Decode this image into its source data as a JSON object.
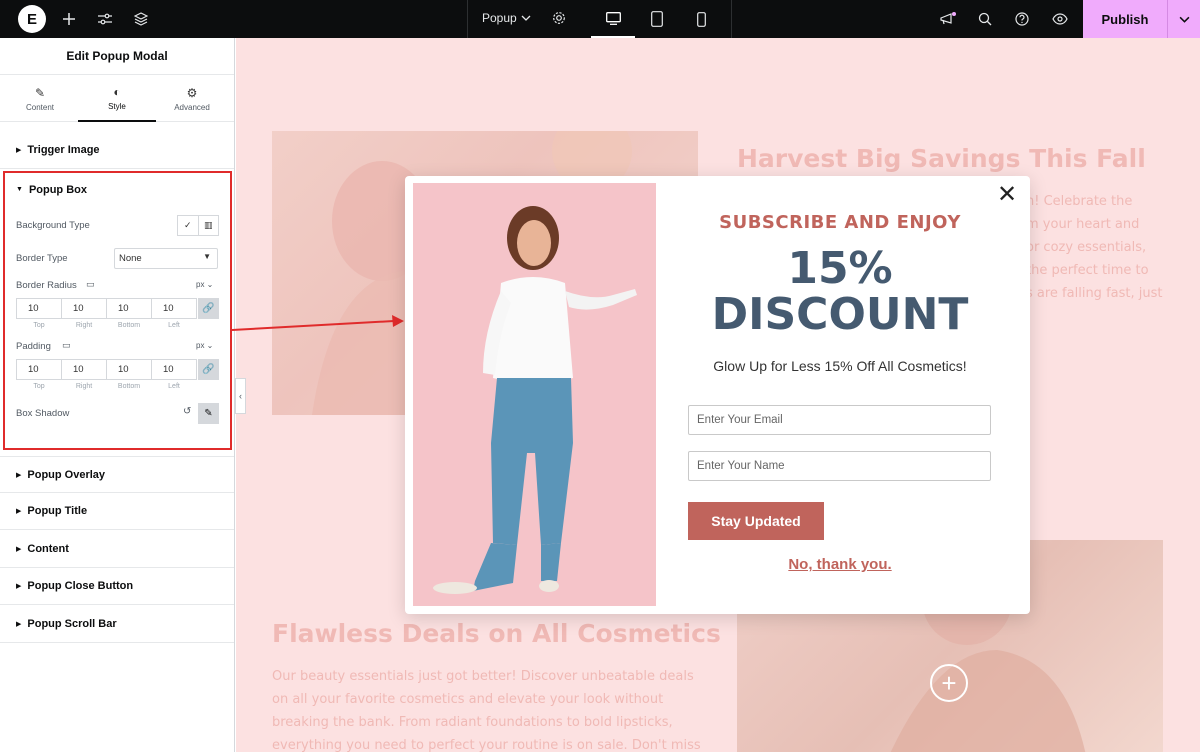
{
  "topbar": {
    "popup_label": "Popup",
    "publish_label": "Publish"
  },
  "panel": {
    "title": "Edit Popup Modal",
    "tabs": [
      {
        "label": "Content",
        "icon": "pencil-icon"
      },
      {
        "label": "Style",
        "icon": "half-circle-icon"
      },
      {
        "label": "Advanced",
        "icon": "gear-icon"
      }
    ],
    "sections": {
      "trigger_image": "Trigger Image",
      "popup_box": "Popup Box",
      "popup_overlay": "Popup Overlay",
      "popup_title": "Popup Title",
      "content": "Content",
      "popup_close_button": "Popup Close Button",
      "popup_scroll_bar": "Popup Scroll Bar"
    },
    "popup_box": {
      "background_type_label": "Background Type",
      "border_type_label": "Border Type",
      "border_type_value": "None",
      "border_radius_label": "Border Radius",
      "border_radius_unit": "px",
      "border_radius": [
        "10",
        "10",
        "10",
        "10"
      ],
      "padding_label": "Padding",
      "padding_unit": "px",
      "padding": [
        "10",
        "10",
        "10",
        "10"
      ],
      "sides": [
        "Top",
        "Right",
        "Bottom",
        "Left"
      ],
      "box_shadow_label": "Box Shadow"
    }
  },
  "canvas": {
    "heading_top": "Harvest Big Savings This Fall",
    "para_top": [
      "n! Celebrate the",
      "m your heart and",
      "or cozy essentials,",
      "the perfect time to",
      "s are falling fast, just"
    ],
    "heading_bottom": "Flawless Deals on All Cosmetics",
    "para_bottom": "Our beauty essentials just got better! Discover unbeatable deals on all your favorite cosmetics and elevate your look without breaking the bank. From radiant foundations to bold lipsticks, everything you need to perfect your routine is on sale. Don't miss this chance"
  },
  "modal": {
    "subheading": "SUBSCRIBE AND ENJOY",
    "discount_line1": "15%",
    "discount_line2": "DISCOUNT",
    "tagline": "Glow Up for Less 15% Off All Cosmetics!",
    "email_placeholder": "Enter Your Email",
    "name_placeholder": "Enter Your Name",
    "button_label": "Stay Updated",
    "decline_label": "No, thank you."
  },
  "colors": {
    "accent": "#c0645c",
    "discount_text": "#455a70",
    "canvas_bg": "#fce1e1",
    "publish_bg": "#f0abfc",
    "highlight": "#e02b2b"
  }
}
